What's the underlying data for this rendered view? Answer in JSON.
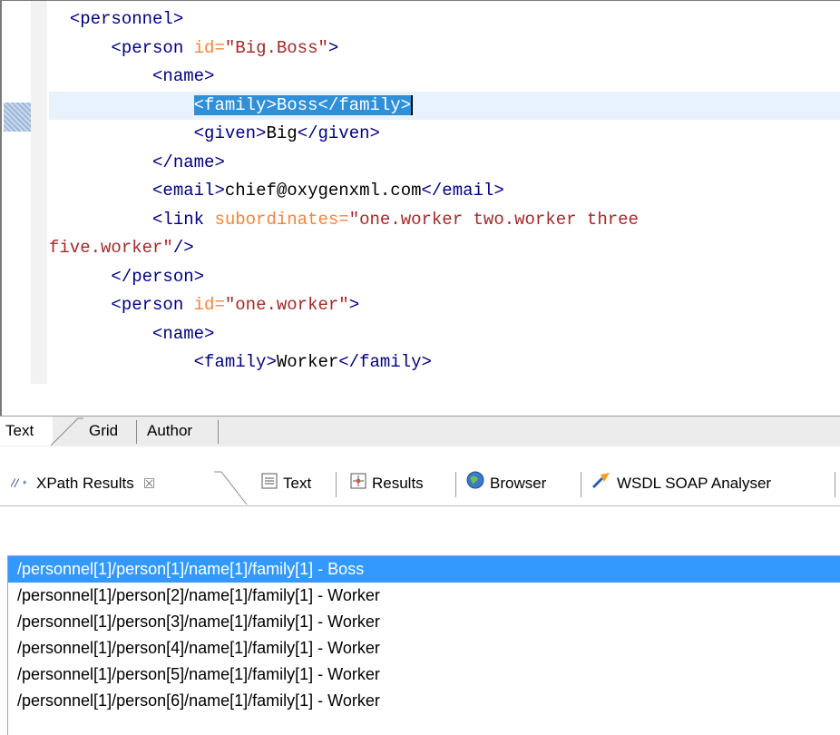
{
  "editor": {
    "lines": [
      {
        "indent": "  ",
        "parts": [
          {
            "c": "t",
            "v": "<personnel>"
          }
        ]
      },
      {
        "indent": "      ",
        "parts": [
          {
            "c": "t",
            "v": "<person "
          },
          {
            "c": "an",
            "v": "id="
          },
          {
            "c": "av",
            "v": "\"Big.Boss\""
          },
          {
            "c": "t",
            "v": ">"
          }
        ]
      },
      {
        "indent": "          ",
        "parts": [
          {
            "c": "t",
            "v": "<name>"
          }
        ]
      },
      {
        "indent": "              ",
        "current": true,
        "parts": [
          {
            "c": "sel",
            "v": "<family>Boss</family>"
          }
        ]
      },
      {
        "indent": "              ",
        "parts": [
          {
            "c": "t",
            "v": "<given>"
          },
          {
            "c": "tx",
            "v": "Big"
          },
          {
            "c": "t",
            "v": "</given>"
          }
        ]
      },
      {
        "indent": "          ",
        "parts": [
          {
            "c": "t",
            "v": "</name>"
          }
        ]
      },
      {
        "indent": "          ",
        "parts": [
          {
            "c": "t",
            "v": "<email>"
          },
          {
            "c": "tx",
            "v": "chief@oxygenxml.com"
          },
          {
            "c": "t",
            "v": "</email>"
          }
        ]
      },
      {
        "indent": "          ",
        "parts": [
          {
            "c": "t",
            "v": "<link "
          },
          {
            "c": "an",
            "v": "subordinates="
          },
          {
            "c": "av",
            "v": "\"one.worker two.worker three"
          }
        ]
      },
      {
        "indent": "",
        "parts": [
          {
            "c": "av",
            "v": "five.worker\""
          },
          {
            "c": "t",
            "v": "/>"
          }
        ]
      },
      {
        "indent": "      ",
        "parts": [
          {
            "c": "t",
            "v": "</person>"
          }
        ]
      },
      {
        "indent": "      ",
        "parts": [
          {
            "c": "t",
            "v": "<person "
          },
          {
            "c": "an",
            "v": "id="
          },
          {
            "c": "av",
            "v": "\"one.worker\""
          },
          {
            "c": "t",
            "v": ">"
          }
        ]
      },
      {
        "indent": "          ",
        "parts": [
          {
            "c": "t",
            "v": "<name>"
          }
        ]
      },
      {
        "indent": "              ",
        "parts": [
          {
            "c": "t",
            "v": "<family>"
          },
          {
            "c": "tx",
            "v": "Worker"
          },
          {
            "c": "t",
            "v": "</family>"
          }
        ]
      }
    ]
  },
  "mode_tabs": {
    "text": "Text",
    "grid": "Grid",
    "author": "Author",
    "active": "Text"
  },
  "view_tabs": {
    "xpath": "XPath Results",
    "xpath_close": "☒",
    "text": "Text",
    "results": "Results",
    "browser": "Browser",
    "wsdl": "WSDL SOAP Analyser"
  },
  "results": [
    {
      "text": "/personnel[1]/person[1]/name[1]/family[1] - Boss",
      "selected": true
    },
    {
      "text": "/personnel[1]/person[2]/name[1]/family[1] - Worker",
      "selected": false
    },
    {
      "text": "/personnel[1]/person[3]/name[1]/family[1] - Worker",
      "selected": false
    },
    {
      "text": "/personnel[1]/person[4]/name[1]/family[1] - Worker",
      "selected": false
    },
    {
      "text": "/personnel[1]/person[5]/name[1]/family[1] - Worker",
      "selected": false
    },
    {
      "text": "/personnel[1]/person[6]/name[1]/family[1] - Worker",
      "selected": false
    }
  ],
  "colors": {
    "tag": "#000080",
    "attr_name": "#f5843c",
    "attr_value": "#a32a2a",
    "selection": "#3399ff",
    "current_line": "#e8f2fc"
  }
}
